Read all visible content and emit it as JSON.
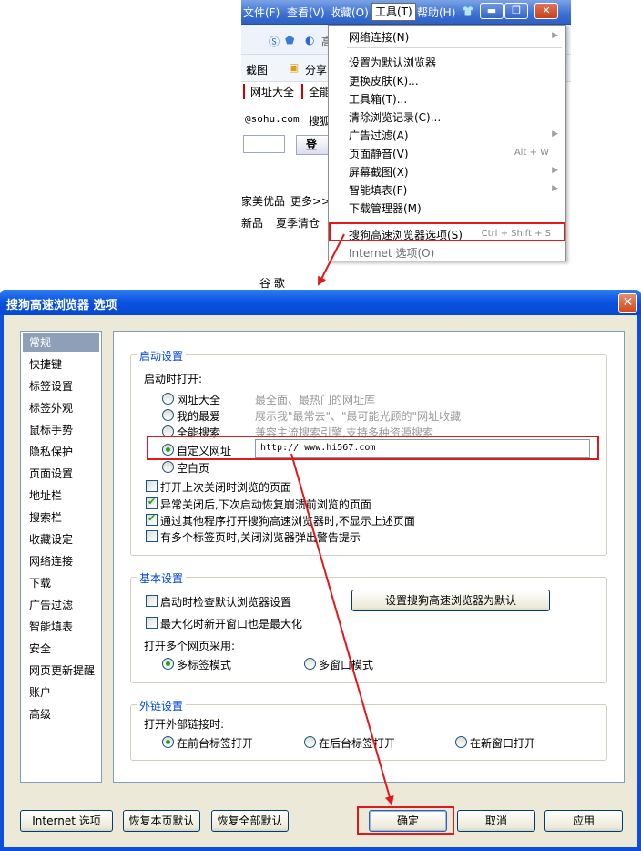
{
  "browser": {
    "menu": [
      "文件(F)",
      "查看(V)",
      "收藏(O)",
      "工具(T)",
      "帮助(H)"
    ],
    "toolbar_fragments": {
      "addr_fragment": "高",
      "screenshot": "截图",
      "share": "分享",
      "url_nav": "网址大全",
      "all_search": "全能"
    },
    "page_fragments": {
      "email": "@sohu.com",
      "search": "搜狐",
      "login": "登",
      "ad1": "家美优品",
      "more": "更多>>",
      "ad2": "新品",
      "ad3": "夏季清仓",
      "google": "谷 歌"
    }
  },
  "tools_menu": {
    "items": [
      {
        "label": "网络连接(N)",
        "shortcut": "",
        "arrow": true
      },
      {
        "label": "设置为默认浏览器",
        "shortcut": "",
        "arrow": false
      },
      {
        "label": "更换皮肤(K)...",
        "shortcut": "",
        "arrow": false
      },
      {
        "label": "工具箱(T)...",
        "shortcut": "",
        "arrow": false
      },
      {
        "label": "清除浏览记录(C)...",
        "shortcut": "",
        "arrow": false
      },
      {
        "label": "广告过滤(A)",
        "shortcut": "",
        "arrow": true
      },
      {
        "label": "页面静音(V)",
        "shortcut": "Alt + W",
        "arrow": false
      },
      {
        "label": "屏幕截图(X)",
        "shortcut": "",
        "arrow": true
      },
      {
        "label": "智能填表(F)",
        "shortcut": "",
        "arrow": true
      },
      {
        "label": "下载管理器(M)",
        "shortcut": "",
        "arrow": false
      },
      {
        "label": "搜狗高速浏览器选项(S)",
        "shortcut": "Ctrl + Shift + S",
        "arrow": false
      },
      {
        "label": "Internet 选项(O)",
        "shortcut": "",
        "arrow": false
      }
    ]
  },
  "dialog": {
    "title": "搜狗高速浏览器 选项",
    "nav": [
      "常规",
      "快捷键",
      "标签设置",
      "标签外观",
      "鼠标手势",
      "隐私保护",
      "页面设置",
      "地址栏",
      "搜索栏",
      "收藏设定",
      "网络连接",
      "下载",
      "广告过滤",
      "智能填表",
      "安全",
      "网页更新提醒",
      "账户",
      "高级"
    ],
    "nav_selected": "常规",
    "startup": {
      "group_title": "启动设置",
      "open_label": "启动时打开:",
      "options": [
        {
          "label": "网址大全",
          "desc": "最全面、最热门的网址库"
        },
        {
          "label": "我的最爱",
          "desc": "展示我\"最常去\"、\"最可能光顾的\"网址收藏"
        },
        {
          "label": "全能搜索",
          "desc": "兼容主流搜索引擎,支持多种资源搜索"
        },
        {
          "label": "自定义网址",
          "desc": ""
        },
        {
          "label": "空白页",
          "desc": ""
        }
      ],
      "selected": "自定义网址",
      "custom_url": "http:// www.hi567.com",
      "checks": [
        {
          "label": "打开上次关闭时浏览的页面",
          "checked": false
        },
        {
          "label": "异常关闭后,下次启动恢复崩溃前浏览的页面",
          "checked": true
        },
        {
          "label": "通过其他程序打开搜狗高速浏览器时,不显示上述页面",
          "checked": true
        },
        {
          "label": "有多个标签页时,关闭浏览器弹出警告提示",
          "checked": false
        }
      ]
    },
    "basic": {
      "group_title": "基本设置",
      "check_default": "启动时检查默认浏览器设置",
      "check_maximize": "最大化时新开窗口也是最大化",
      "set_default_button": "设置搜狗高速浏览器为默认",
      "multi_label": "打开多个网页采用:",
      "multi_tab": "多标签模式",
      "multi_window": "多窗口模式"
    },
    "external": {
      "group_title": "外链设置",
      "label": "打开外部链接时:",
      "options": [
        "在前台标签打开",
        "在后台标签打开",
        "在新窗口打开"
      ],
      "selected": "在前台标签打开"
    },
    "buttons": {
      "internet_options": "Internet 选项",
      "restore_page": "恢复本页默认",
      "restore_all": "恢复全部默认",
      "ok": "确定",
      "cancel": "取消",
      "apply": "应用"
    }
  },
  "colors": {
    "annotation_red": "#e0191d",
    "title_blue": "#0a51df",
    "group_title": "#0046d5"
  }
}
